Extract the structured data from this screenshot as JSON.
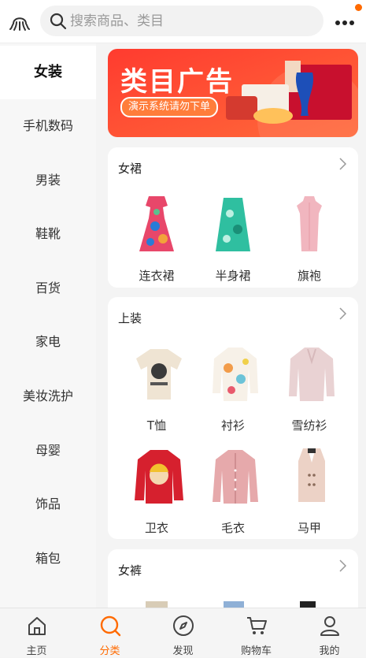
{
  "header": {
    "logo_icon": "octopus-logo-icon",
    "search_placeholder": "搜索商品、类目",
    "more_icon": "more-dots-icon",
    "badge_color": "#ff6a00"
  },
  "sidebar": {
    "items": [
      {
        "label": "女装",
        "active": true
      },
      {
        "label": "手机数码"
      },
      {
        "label": "男装"
      },
      {
        "label": "鞋靴"
      },
      {
        "label": "百货"
      },
      {
        "label": "家电"
      },
      {
        "label": "美妆洗护"
      },
      {
        "label": "母婴"
      },
      {
        "label": "饰品"
      },
      {
        "label": "箱包"
      }
    ]
  },
  "banner": {
    "title": "类目广告",
    "subtitle": "演示系统请勿下单"
  },
  "sections": [
    {
      "title": "女裙",
      "items": [
        {
          "label": "连衣裙"
        },
        {
          "label": "半身裙"
        },
        {
          "label": "旗袍"
        }
      ]
    },
    {
      "title": "上装",
      "items": [
        {
          "label": "T恤"
        },
        {
          "label": "衬衫"
        },
        {
          "label": "雪纺衫"
        },
        {
          "label": "卫衣"
        },
        {
          "label": "毛衣"
        },
        {
          "label": "马甲"
        }
      ]
    },
    {
      "title": "女裤",
      "items": []
    }
  ],
  "tabbar": {
    "accent_color": "#ff6a00",
    "tabs": [
      {
        "label": "主页",
        "icon": "home-icon"
      },
      {
        "label": "分类",
        "icon": "category-search-icon",
        "active": true
      },
      {
        "label": "发现",
        "icon": "compass-icon"
      },
      {
        "label": "购物车",
        "icon": "cart-icon"
      },
      {
        "label": "我的",
        "icon": "user-icon"
      }
    ]
  }
}
